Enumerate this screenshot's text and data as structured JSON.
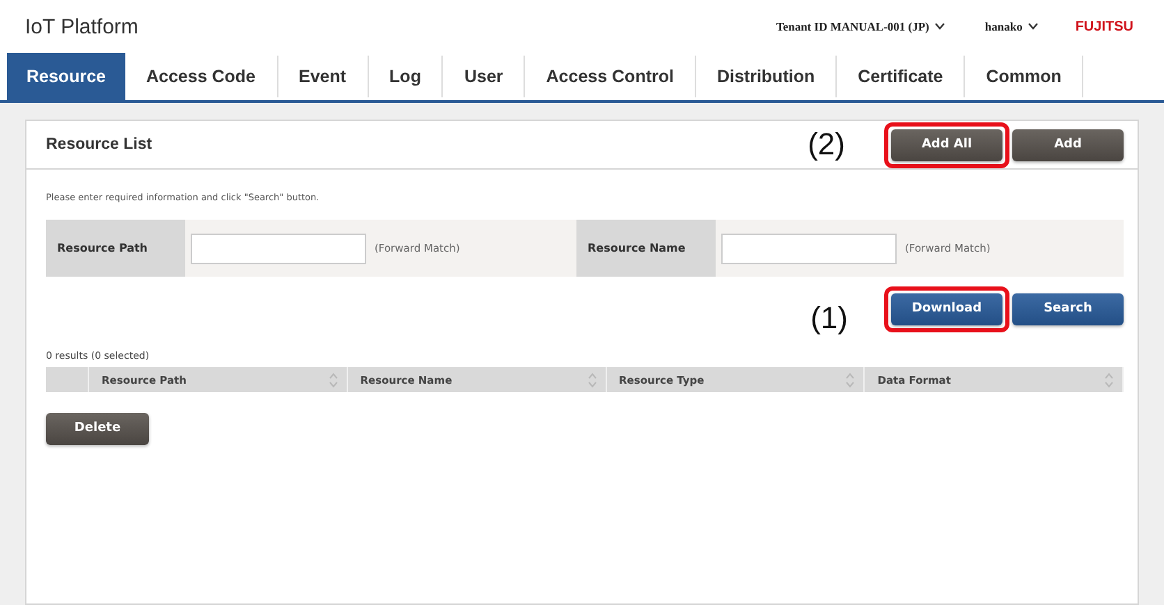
{
  "header": {
    "app_title": "IoT Platform",
    "tenant": "Tenant ID MANUAL-001 (JP)",
    "user": "hanako",
    "logo": "FUJITSU"
  },
  "tabs": [
    {
      "label": "Resource",
      "selected": true
    },
    {
      "label": "Access Code",
      "selected": false
    },
    {
      "label": "Event",
      "selected": false
    },
    {
      "label": "Log",
      "selected": false
    },
    {
      "label": "User",
      "selected": false
    },
    {
      "label": "Access Control",
      "selected": false
    },
    {
      "label": "Distribution",
      "selected": false
    },
    {
      "label": "Certificate",
      "selected": false
    },
    {
      "label": "Common",
      "selected": false
    }
  ],
  "panel": {
    "title": "Resource List",
    "header_buttons": [
      {
        "label": "Add All",
        "highlighted": true,
        "callout": "(2)"
      },
      {
        "label": "Add",
        "highlighted": false
      }
    ],
    "instruction": "Please enter required information and click \"Search\" button.",
    "filters": [
      {
        "label": "Resource Path",
        "hint": "(Forward Match)"
      },
      {
        "label": "Resource Name",
        "hint": "(Forward Match)"
      }
    ],
    "search_buttons": [
      {
        "label": "Download",
        "highlighted": true,
        "callout": "(1)"
      },
      {
        "label": "Search",
        "highlighted": false
      }
    ],
    "results": "0 results (0 selected)",
    "table": {
      "columns": [
        "Resource Path",
        "Resource Name",
        "Resource Type",
        "Data Format"
      ]
    },
    "delete_button": "Delete"
  }
}
